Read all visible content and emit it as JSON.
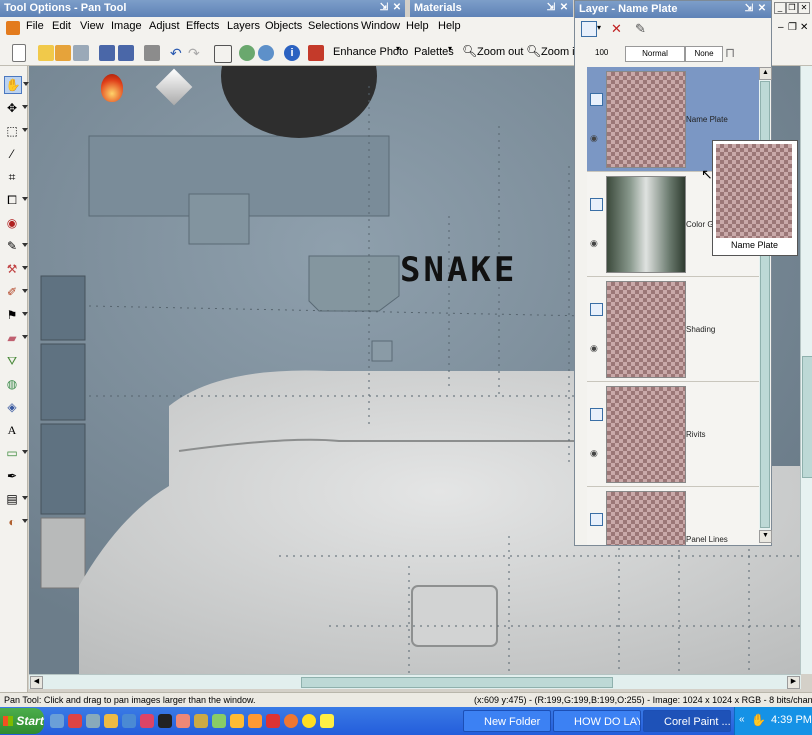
{
  "panels": {
    "tool_options_title": "Tool Options - Pan Tool",
    "materials_title": "Materials",
    "layer_title": "Layer - Name Plate"
  },
  "menu": [
    "File",
    "Edit",
    "View",
    "Image",
    "Adjust",
    "Effects",
    "Layers",
    "Objects",
    "Selections",
    "Window",
    "Help",
    "Help"
  ],
  "toolbar": {
    "enhance_photo": "Enhance Photo",
    "palettes": "Palettes",
    "zoom_out": "Zoom out",
    "zoom_in": "Zoom in"
  },
  "layer_toolbar": {
    "opacity": "100",
    "blend_mode": "Normal",
    "mask": "None"
  },
  "canvas": {
    "text": "SNAKE"
  },
  "layers": [
    {
      "name": "Name Plate",
      "selected": true
    },
    {
      "name": "Color Gr..."
    },
    {
      "name": "Shading"
    },
    {
      "name": "Rivits"
    },
    {
      "name": "Panel Lines"
    }
  ],
  "tooltip": {
    "name": "Name Plate"
  },
  "status": {
    "left": "Pan Tool: Click and drag to pan images larger than the window.",
    "right": "(x:609 y:475) - (R:199,G:199,B:199,O:255) - Image: 1024 x 1024 x RGB - 8 bits/channel"
  },
  "taskbar": {
    "start": "Start",
    "items": [
      "New Folder",
      "HOW DO LAY...",
      "Corel Paint ..."
    ],
    "clock": "4:39 PM"
  },
  "colors": {
    "title_blue": "#5e82b6",
    "selected_layer": "#7b97c4",
    "taskbar_blue": "#245ddb",
    "start_green": "#3c9a3c"
  }
}
